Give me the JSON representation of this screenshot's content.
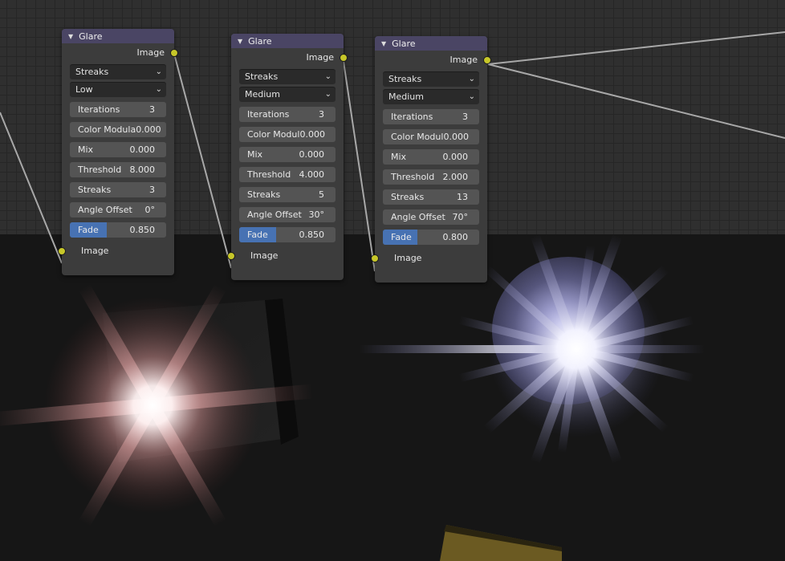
{
  "nodes": [
    {
      "title": "Glare",
      "output_label": "Image",
      "glare_type": "Streaks",
      "quality": "Low",
      "fields": [
        {
          "label": "Iterations",
          "value": "3"
        },
        {
          "label": "Color Modula",
          "value": "0.000"
        },
        {
          "label": "Mix",
          "value": "0.000"
        },
        {
          "label": "Threshold",
          "value": "8.000"
        },
        {
          "label": "Streaks",
          "value": "3"
        },
        {
          "label": "Angle Offset",
          "value": "0°"
        }
      ],
      "fade": {
        "label": "Fade",
        "value": "0.850",
        "fraction": 0.85
      },
      "input_label": "Image"
    },
    {
      "title": "Glare",
      "output_label": "Image",
      "glare_type": "Streaks",
      "quality": "Medium",
      "fields": [
        {
          "label": "Iterations",
          "value": "3"
        },
        {
          "label": "Color Modul",
          "value": "0.000"
        },
        {
          "label": "Mix",
          "value": "0.000"
        },
        {
          "label": "Threshold",
          "value": "4.000"
        },
        {
          "label": "Streaks",
          "value": "5"
        },
        {
          "label": "Angle Offset",
          "value": "30°"
        }
      ],
      "fade": {
        "label": "Fade",
        "value": "0.850",
        "fraction": 0.85
      },
      "input_label": "Image"
    },
    {
      "title": "Glare",
      "output_label": "Image",
      "glare_type": "Streaks",
      "quality": "Medium",
      "fields": [
        {
          "label": "Iterations",
          "value": "3"
        },
        {
          "label": "Color Modul",
          "value": "0.000"
        },
        {
          "label": "Mix",
          "value": "0.000"
        },
        {
          "label": "Threshold",
          "value": "2.000"
        },
        {
          "label": "Streaks",
          "value": "13"
        },
        {
          "label": "Angle Offset",
          "value": "70°"
        }
      ],
      "fade": {
        "label": "Fade",
        "value": "0.800",
        "fraction": 0.8
      },
      "input_label": "Image"
    }
  ],
  "colors": {
    "header": "#4a4564",
    "socket": "#c7c729",
    "slider_fill": "#4772b3",
    "grid_bg": "#2f2f2f",
    "backdrop": "#161616"
  },
  "icons": {
    "collapse": "triangle-down-icon",
    "dropdown": "chevron-down-icon"
  }
}
